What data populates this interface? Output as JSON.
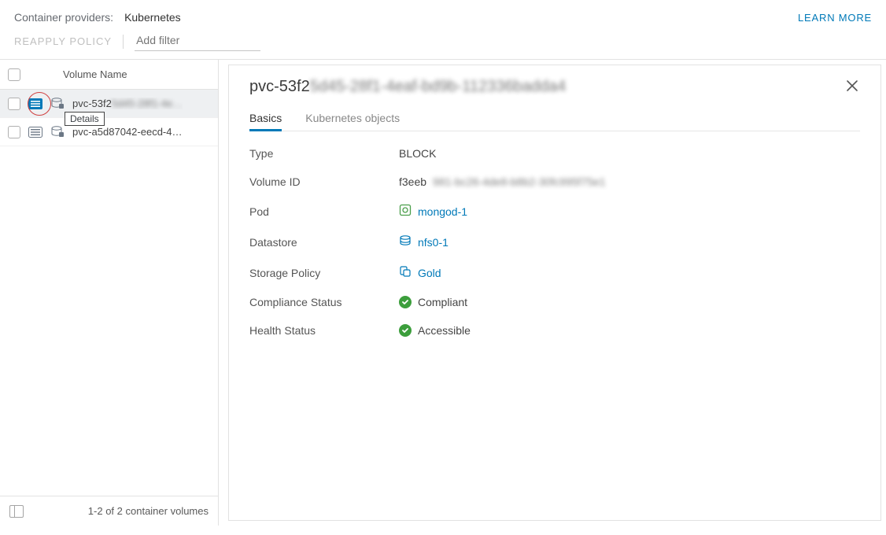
{
  "header": {
    "label": "Container providers:",
    "value": "Kubernetes",
    "learn_more": "LEARN MORE"
  },
  "actions": {
    "reapply": "REAPPLY POLICY",
    "add_filter_placeholder": "Add filter"
  },
  "list": {
    "column": "Volume Name",
    "rows": [
      {
        "name_vis": "pvc-53f2",
        "name_rest": "5d45-28f1-4e…",
        "selected": true
      },
      {
        "name_vis": "pvc-a5d87042-eecd-4…",
        "name_rest": "",
        "selected": false
      }
    ],
    "tooltip": "Details",
    "footer": "1-2 of 2 container volumes"
  },
  "detail": {
    "title_vis": "pvc-53f2",
    "title_rest": "5d45-28f1-4eaf-bd9b-112336badda4",
    "tabs": {
      "basics": "Basics",
      "k8s": "Kubernetes objects"
    },
    "kv": {
      "type": {
        "label": "Type",
        "value": "BLOCK"
      },
      "volume_id": {
        "label": "Volume ID",
        "value_vis": "f3eeb",
        "value_rest": "981-bc26-4de8-b8b2-30fc995f75e1"
      },
      "pod": {
        "label": "Pod",
        "value": "mongod-1"
      },
      "datastore": {
        "label": "Datastore",
        "value": "nfs0-1"
      },
      "storage_policy": {
        "label": "Storage Policy",
        "value": "Gold"
      },
      "compliance": {
        "label": "Compliance Status",
        "value": "Compliant"
      },
      "health": {
        "label": "Health Status",
        "value": "Accessible"
      }
    }
  }
}
